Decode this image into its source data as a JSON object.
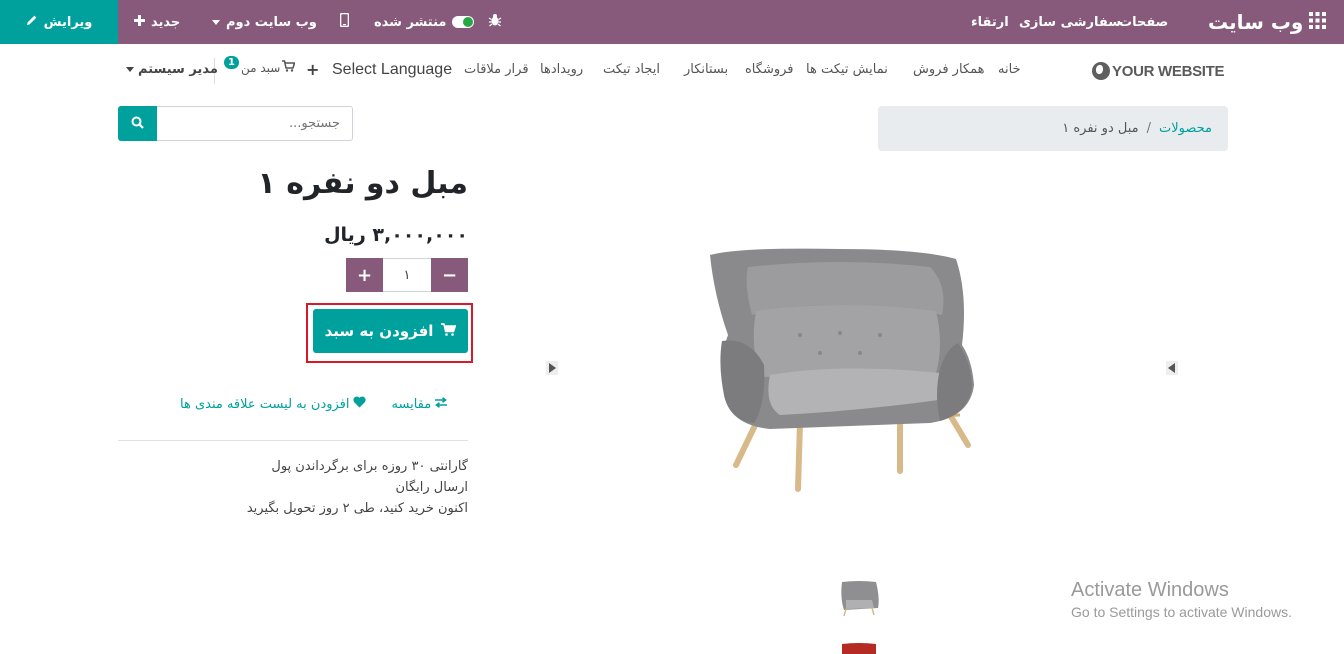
{
  "adminbar": {
    "edit_label": "ویرایش",
    "new_label": "جدید",
    "site_menu_label": "وب سایت دوم",
    "published_label": "منتشر شده",
    "brand": "وب سایت",
    "pages_label": "صفحات",
    "customize_label": "سفارشی سازی",
    "upgrade_label": "ارتقاء",
    "bg_color": "#875a7b",
    "accent_color": "#00a09d"
  },
  "nav": {
    "logo_text": "YOUR WEBSITE",
    "links": [
      "خانه",
      "همکار فروش",
      "نمایش تیکت ها",
      "فروشگاه",
      "بستانکار",
      "ایجاد تیکت",
      "رویدادها",
      "قرار ملاقات"
    ],
    "select_language": "Select Language",
    "cart_label": "سبد من",
    "cart_count": "1",
    "admin_label": "مدیر سیستم"
  },
  "search": {
    "placeholder": "جستجو..."
  },
  "breadcrumb": {
    "parent": "محصولات",
    "separator": "/",
    "current": "مبل دو نفره ۱"
  },
  "product": {
    "title": "مبل دو نفره ۱",
    "price": "۳,۰۰۰,۰۰۰ ریال",
    "quantity": "۱",
    "add_to_cart": "افزودن به سبد",
    "compare": "مقایسه",
    "wishlist": "افزودن به لیست علاقه مندی ها",
    "terms": [
      "گارانتی ۳۰ روزه برای برگرداندن پول",
      "ارسال رایگان",
      "اکنون خرید کنید، طی ۲ روز تحویل بگیرید"
    ]
  },
  "watermark": {
    "title": "Activate Windows",
    "subtitle": "Go to Settings to activate Windows."
  }
}
